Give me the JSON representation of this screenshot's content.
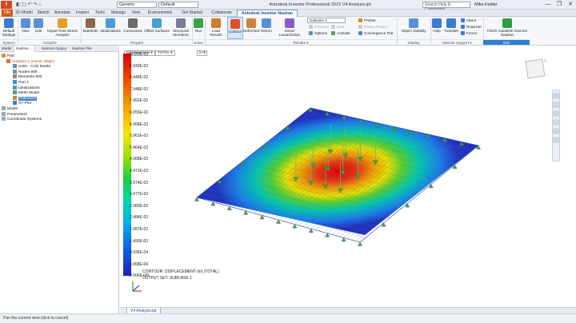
{
  "title_bar": {
    "app_badge": "I",
    "quick_material": "Generic",
    "quick_appearance": "Default",
    "window_title": "Autodesk Inventor Professional 2022    V4 Analysis.ipt",
    "search_placeholder": "Search Help & Commands...",
    "user": "Mike.Fedler",
    "window_controls": [
      "—",
      "❐",
      "✕"
    ]
  },
  "ribbon_tabs": [
    "File",
    "3D Model",
    "Sketch",
    "Annotate",
    "Inspect",
    "Tools",
    "Manage",
    "View",
    "Environments",
    "Get Started",
    "Collaborate",
    "Autodesk Inventor Nastran"
  ],
  "active_tab": "Autodesk Inventor Nastran",
  "ribbon": {
    "groups": [
      {
        "label": "System"
      },
      {
        "label": "Analysis"
      },
      {
        "label": "Prepare"
      },
      {
        "label": "Solve"
      },
      {
        "label": "Results ▾"
      },
      {
        "label": "Display"
      },
      {
        "label": "Nastran Support ▾"
      },
      {
        "label": "Exit"
      }
    ],
    "buttons": [
      {
        "label": "Default Settings",
        "icon": "settings-icon",
        "color": "#3a7bd5"
      },
      {
        "label": "New",
        "icon": "new-icon",
        "color": "#5a8fd8"
      },
      {
        "label": "Edit",
        "icon": "edit-icon",
        "color": "#5a8fd8"
      },
      {
        "label": "Import from Stress Analysis",
        "icon": "import-icon",
        "color": "#e0a020"
      },
      {
        "label": "Materials",
        "icon": "materials-icon",
        "color": "#8a6a4a"
      },
      {
        "label": "Idealizations",
        "icon": "idealizations-icon",
        "color": "#4a9ad8"
      },
      {
        "label": "Connectors",
        "icon": "connectors-icon",
        "color": "#6a6a6a"
      },
      {
        "label": "Offset Surfaces",
        "icon": "offset-surfaces-icon",
        "color": "#4aa0d0"
      },
      {
        "label": "Structural Members",
        "icon": "structural-members-icon",
        "color": "#7a7a9a"
      },
      {
        "label": "Run",
        "icon": "run-icon",
        "color": "#3aa04a"
      },
      {
        "label": "Load Results",
        "icon": "load-results-icon",
        "color": "#d07a2a"
      },
      {
        "label": "Contour",
        "icon": "contour-icon",
        "color": "#e05030"
      },
      {
        "label": "Deformed",
        "icon": "deformed-icon",
        "color": "#d08040"
      },
      {
        "label": "Return",
        "icon": "return-icon",
        "color": "#5a8fd8"
      },
      {
        "label": "Stress Linearization",
        "icon": "stress-linearization-icon",
        "color": "#8a5ac8"
      },
      {
        "label": "Object Visibility",
        "icon": "object-visibility-icon",
        "color": "#5a8fd8"
      },
      {
        "label": "Help",
        "icon": "help-icon",
        "color": "#3a7bd5"
      },
      {
        "label": "Tutorials",
        "icon": "tutorials-icon",
        "color": "#3a7bd5"
      },
      {
        "label": "Finish Autodesk Inventor Nastran",
        "icon": "finish-icon",
        "color": "#2aa040"
      }
    ],
    "results_small": {
      "subcase": "Subcase 1",
      "previous": "Previous",
      "next": "Next",
      "options": "Options",
      "animate": "Animate",
      "probes": "Probes",
      "delete_probes": "Delete Probes",
      "convergence": "Convergence Plot"
    },
    "support_small": {
      "about": "About",
      "readme": "Read Me",
      "forum": "Forum"
    }
  },
  "browser": {
    "tabs": [
      "Model",
      "Nastran ...",
      "Nastran Output",
      "Nastran File"
    ],
    "items": [
      {
        "label": "Part",
        "level": 0,
        "selected": false
      },
      {
        "label": "Analysis 1 (Linear Static)",
        "level": 1,
        "selected": false
      },
      {
        "label": "Units - CAD Model",
        "level": 2,
        "selected": false
      },
      {
        "label": "Nodes 908",
        "level": 2,
        "selected": false
      },
      {
        "label": "Elements 800",
        "level": 2,
        "selected": false
      },
      {
        "label": "Part 1",
        "level": 2,
        "selected": false
      },
      {
        "label": "Idealizations",
        "level": 2,
        "selected": false
      },
      {
        "label": "Mesh Model",
        "level": 2,
        "selected": false
      },
      {
        "label": "Subcases",
        "level": 2,
        "selected": true
      },
      {
        "label": "XY Plot",
        "level": 2,
        "selected": false
      },
      {
        "label": "Model",
        "level": 0,
        "selected": false
      },
      {
        "label": "Parameters",
        "level": 0,
        "selected": false
      },
      {
        "label": "Coordinate Systems",
        "level": 0,
        "selected": false
      }
    ]
  },
  "viewport": {
    "result_type": "Displacement ▾",
    "component": "TOTAL ▾",
    "unit": "in ▾",
    "legend_values": [
      "9.935E-03",
      "8.942E-03",
      "8.445E-03",
      "7.948E-03",
      "7.452E-03",
      "6.955E-03",
      "6.458E-03",
      "5.961E-03",
      "5.464E-03",
      "4.968E-03",
      "4.471E-03",
      "3.974E-03",
      "3.477E-03",
      "2.980E-03",
      "2.484E-03",
      "1.987E-03",
      "1.490E-03",
      "9.935E-04",
      "4.968E-04",
      "0.000E+00"
    ],
    "contour_label": "CONTOUR: DISPLACEMENT (in) (TOTAL)",
    "output_set_label": "OUTPUT SET: SUBCASE 1",
    "axis_labels": [
      "X",
      "Y",
      "Z"
    ]
  },
  "document_tab": "V4 Analysis.ipt",
  "status_bar": "Pan the current view (click to cancel)"
}
